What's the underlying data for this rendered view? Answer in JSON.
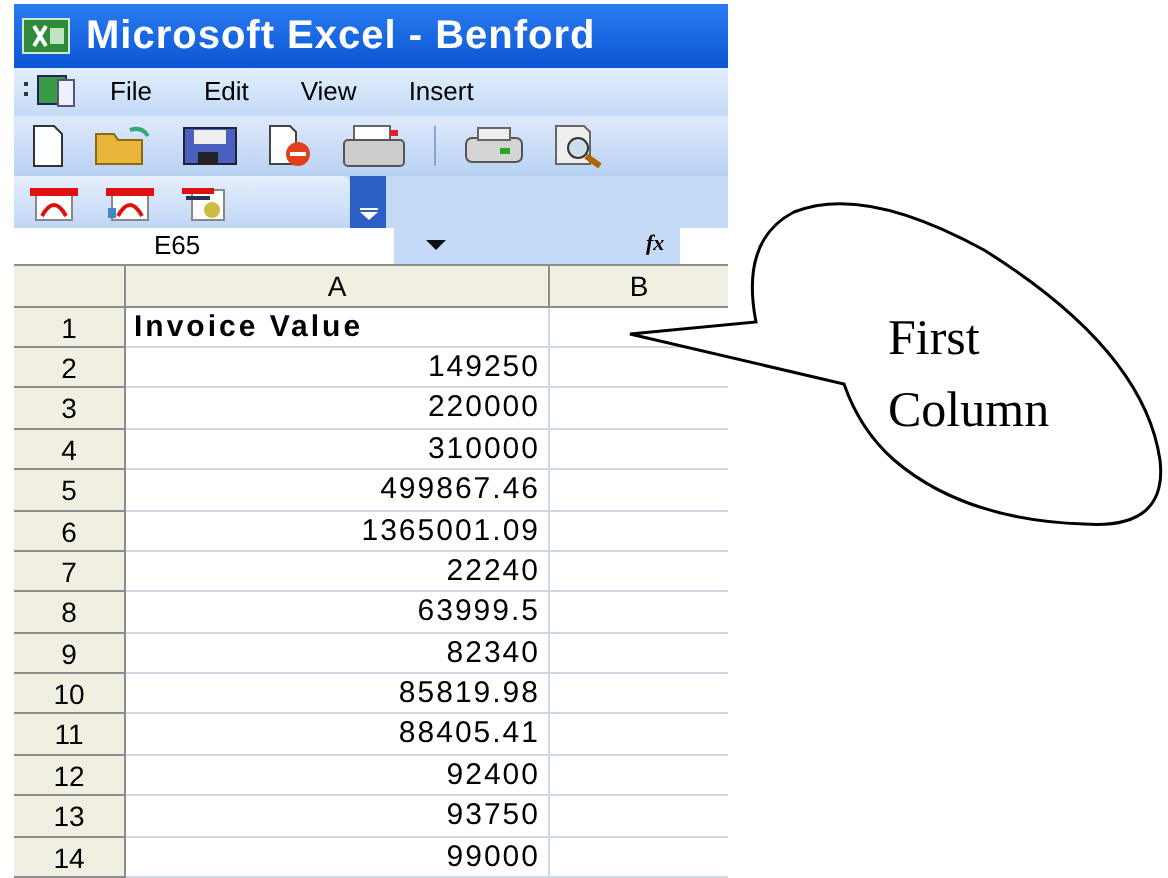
{
  "window": {
    "title": "Microsoft Excel - Benford"
  },
  "menu": [
    "File",
    "Edit",
    "View",
    "Insert"
  ],
  "name_box": "E65",
  "formula_icon": "fx",
  "columns": [
    "A",
    "B"
  ],
  "rows": [
    {
      "n": "1",
      "a": "Invoice Value",
      "kind": "header"
    },
    {
      "n": "2",
      "a": "149250",
      "kind": "number"
    },
    {
      "n": "3",
      "a": "220000",
      "kind": "number"
    },
    {
      "n": "4",
      "a": "310000",
      "kind": "number"
    },
    {
      "n": "5",
      "a": "499867.46",
      "kind": "number"
    },
    {
      "n": "6",
      "a": "1365001.09",
      "kind": "number"
    },
    {
      "n": "7",
      "a": "22240",
      "kind": "number"
    },
    {
      "n": "8",
      "a": "63999.5",
      "kind": "number"
    },
    {
      "n": "9",
      "a": "82340",
      "kind": "number"
    },
    {
      "n": "10",
      "a": "85819.98",
      "kind": "number"
    },
    {
      "n": "11",
      "a": "88405.41",
      "kind": "number"
    },
    {
      "n": "12",
      "a": "92400",
      "kind": "number"
    },
    {
      "n": "13",
      "a": "93750",
      "kind": "number"
    },
    {
      "n": "14",
      "a": "99000",
      "kind": "number"
    }
  ],
  "callout": {
    "text": "First Column"
  }
}
